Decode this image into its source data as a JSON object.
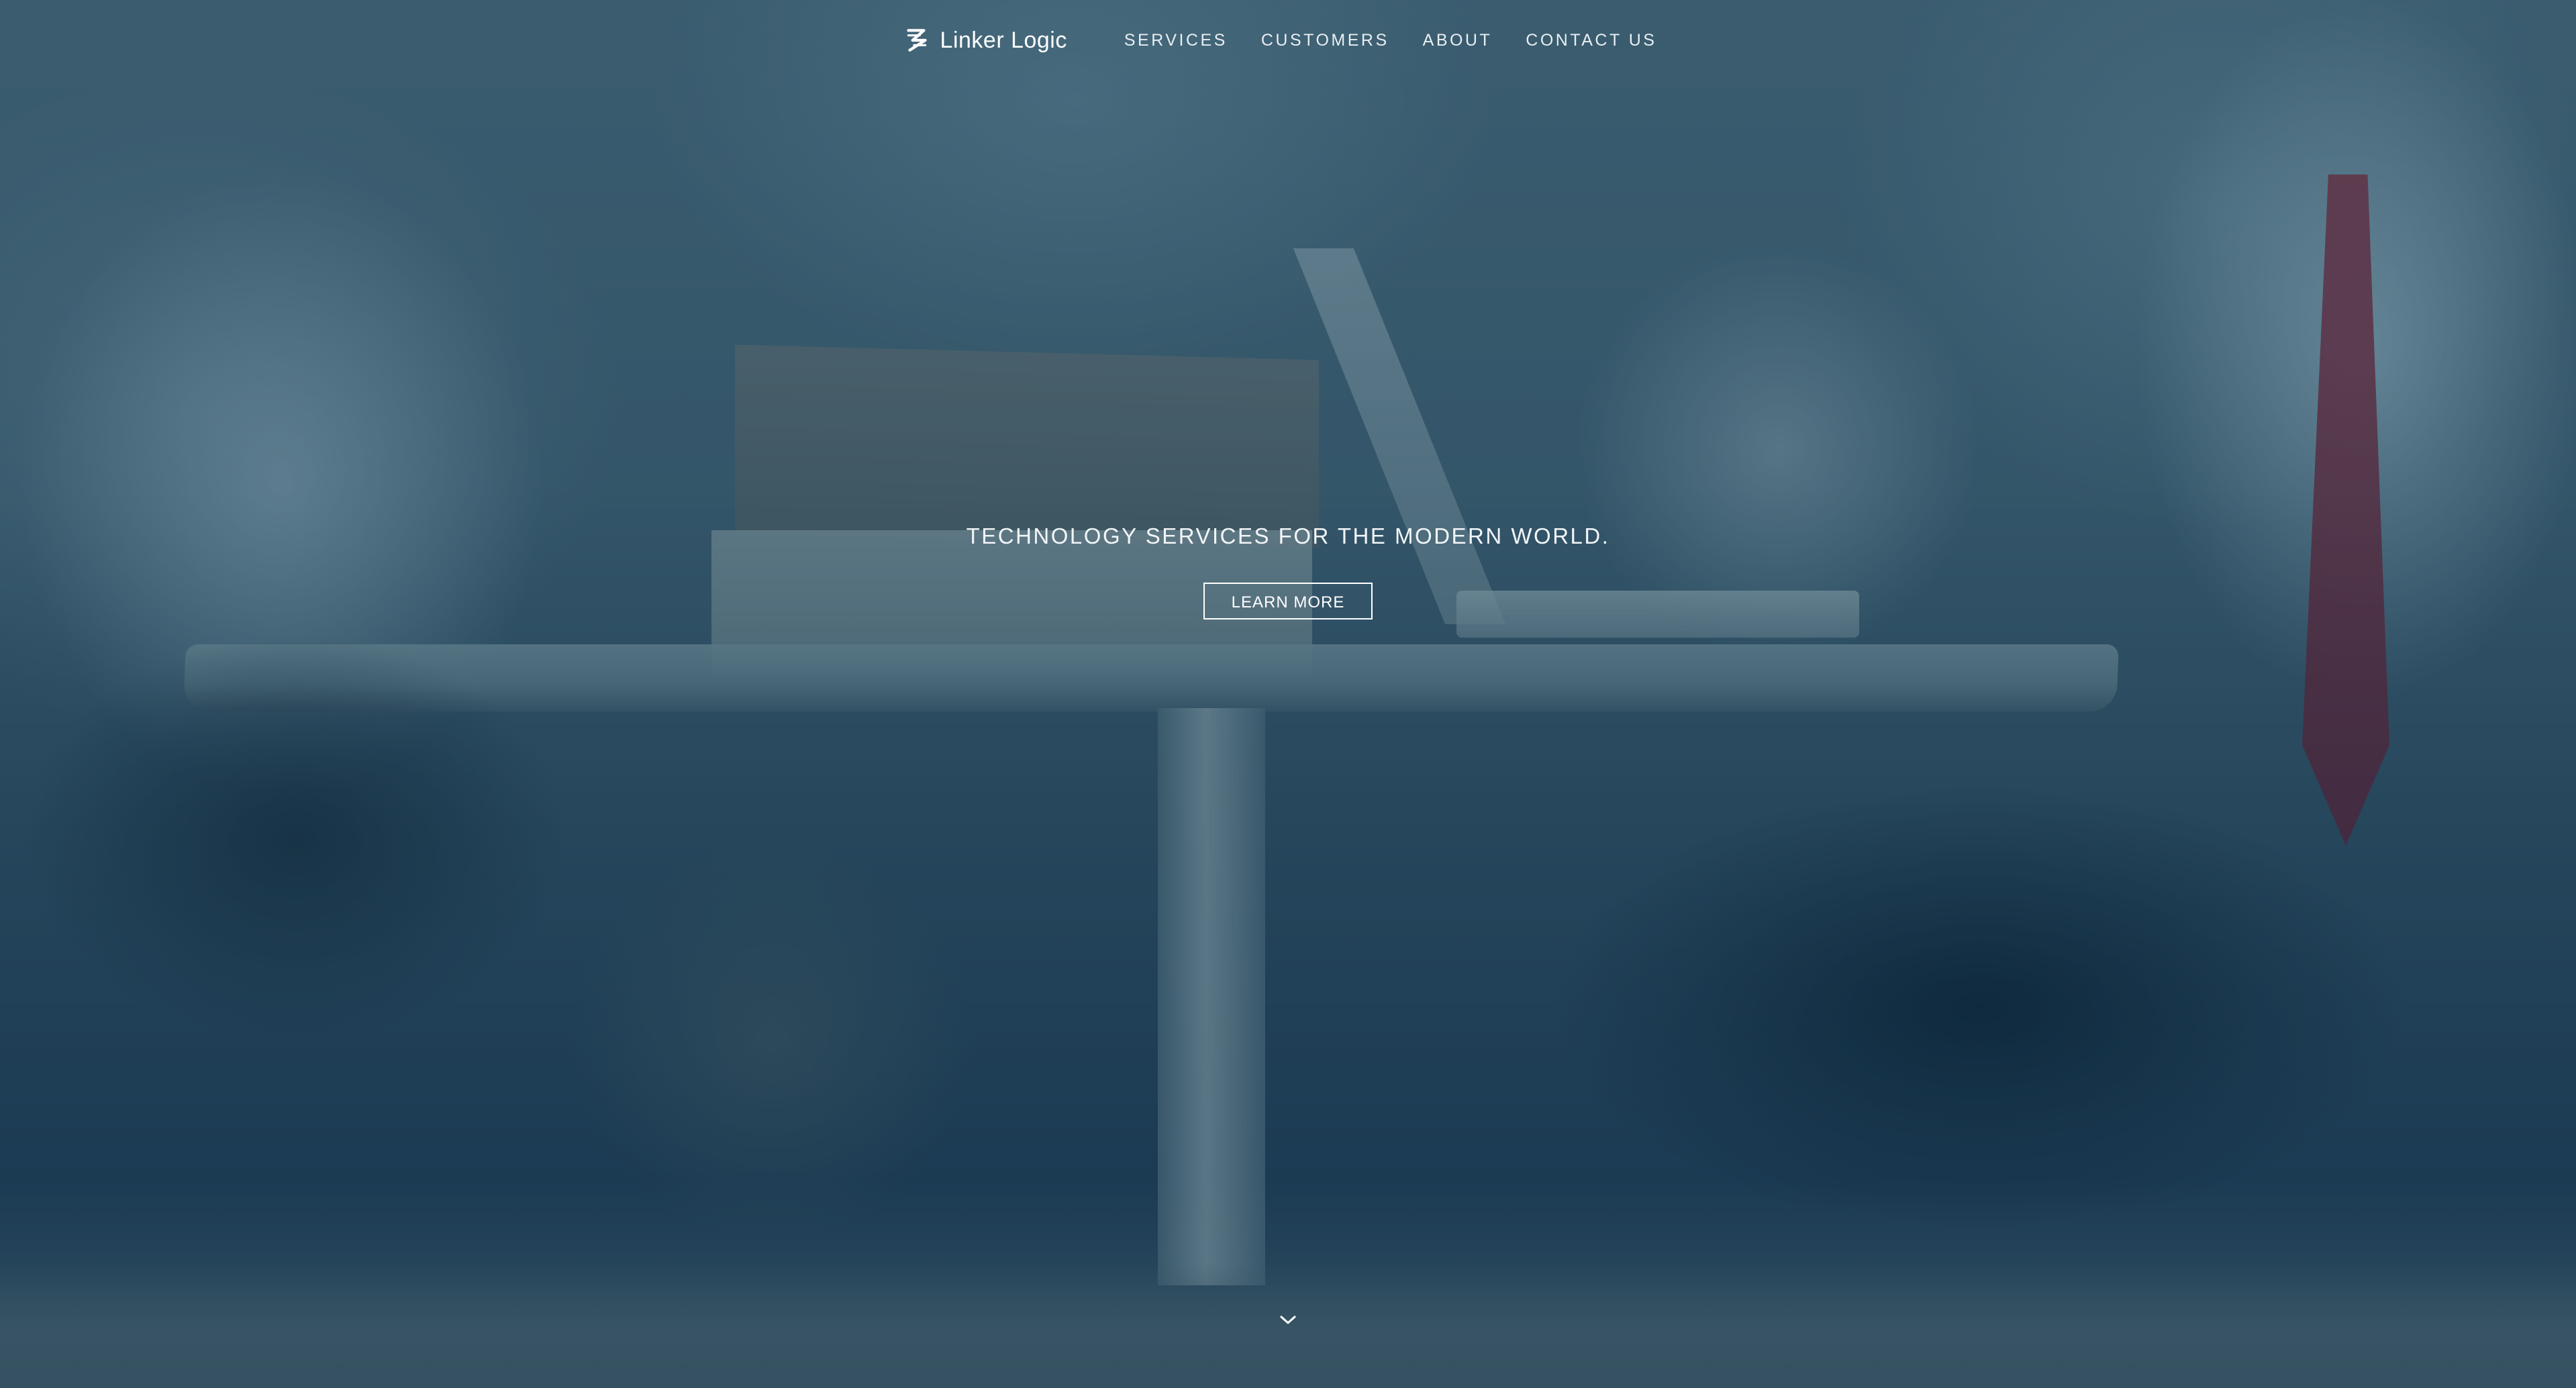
{
  "header": {
    "brand_name": "Linker Logic",
    "logo_icon": "linker-logic-logo-icon",
    "nav": [
      {
        "label": "SERVICES"
      },
      {
        "label": "CUSTOMERS"
      },
      {
        "label": "ABOUT"
      },
      {
        "label": "CONTACT US"
      }
    ]
  },
  "hero": {
    "tagline": "TECHNOLOGY SERVICES FOR THE MODERN WORLD.",
    "cta_label": "LEARN MORE",
    "scroll_icon": "chevron-down-icon",
    "background_image": "office-meeting-photo"
  },
  "colors": {
    "overlay": "#1e3c55",
    "text": "#ffffff"
  }
}
